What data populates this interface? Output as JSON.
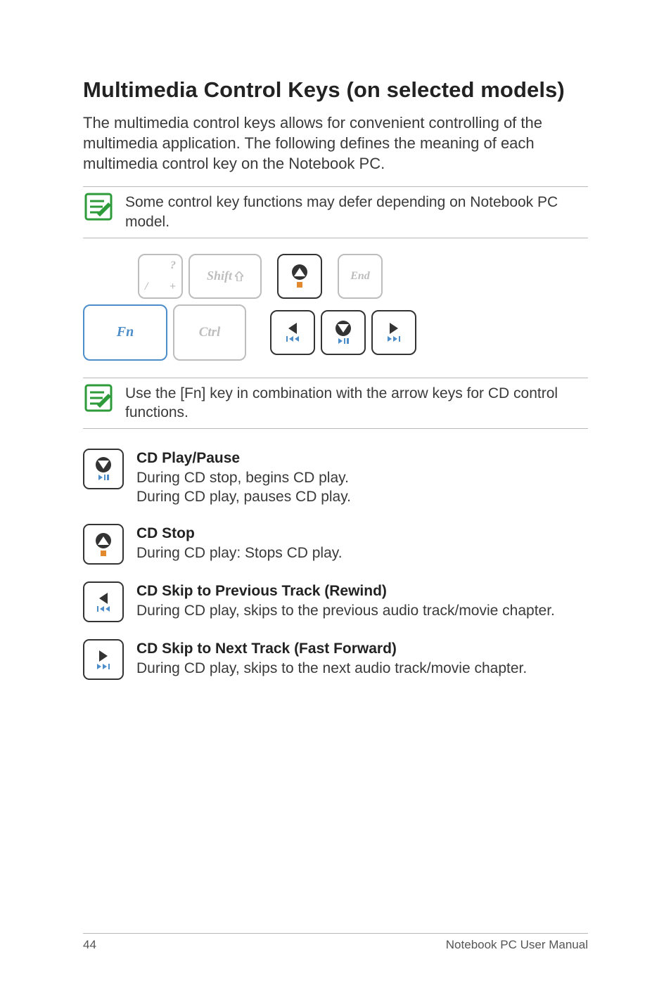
{
  "heading": "Multimedia Control Keys (on selected models)",
  "intro": "The multimedia control keys allows for convenient controlling of the multimedia application. The following defines the meaning of each multimedia control key on the Notebook PC.",
  "note1": "Some control key functions may defer depending on Notebook PC model.",
  "note2": "Use the [Fn] key in combination with the arrow keys for CD control functions.",
  "keys": {
    "fn": "Fn",
    "ctrl": "Ctrl",
    "shift": "Shift",
    "end": "End",
    "slash_top": "?",
    "slash_bottom_left": "/",
    "slash_bottom_right": "+"
  },
  "defs": {
    "play": {
      "title": "CD Play/Pause",
      "line1": "During CD stop, begins CD play.",
      "line2": "During CD play, pauses CD play."
    },
    "stop": {
      "title": "CD Stop",
      "line1": "During CD play: Stops CD play."
    },
    "prev": {
      "title": "CD Skip to Previous Track (Rewind)",
      "line1": "During CD play, skips to the previous audio track/movie chapter."
    },
    "next": {
      "title": "CD Skip to Next Track (Fast Forward)",
      "line1": "During CD play, skips to the next audio track/movie chapter."
    }
  },
  "footer": {
    "page": "44",
    "manual": "Notebook PC User Manual"
  }
}
